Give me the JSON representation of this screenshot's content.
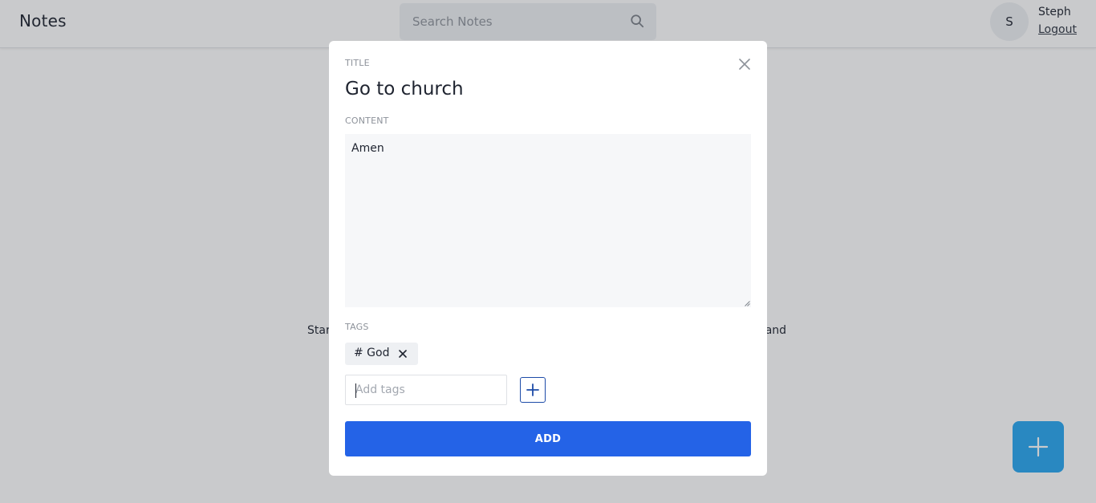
{
  "navbar": {
    "brand": "Notes",
    "search_placeholder": "Search Notes",
    "search_icon": "search-icon",
    "avatar_initial": "S",
    "user_name": "Steph",
    "logout_label": "Logout"
  },
  "background": {
    "empty_left": "Star",
    "empty_right": "and"
  },
  "fab": {
    "icon": "plus-icon"
  },
  "modal": {
    "title_label": "TITLE",
    "title_value": "Go to church",
    "content_label": "CONTENT",
    "content_value": "Amen",
    "tags_label": "TAGS",
    "tags": [
      {
        "text": "# God"
      }
    ],
    "tag_input_placeholder": "Add tags",
    "add_button_label": "ADD"
  },
  "colors": {
    "accent": "#2463e7",
    "fab": "#2aa7f0",
    "overlay": "rgba(40,44,52,0.25)"
  }
}
